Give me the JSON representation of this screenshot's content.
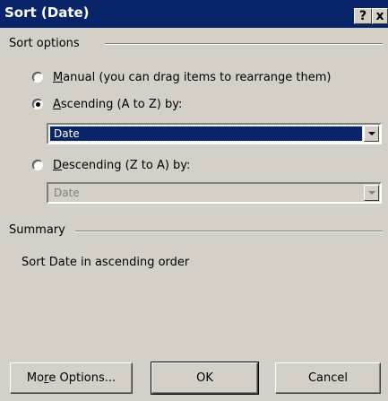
{
  "window": {
    "title": "Sort (Date)",
    "help_glyph": "?",
    "close_glyph": "x"
  },
  "sort_options": {
    "group_label": "Sort options",
    "manual": {
      "access_key": "M",
      "rest": "anual (you can drag items to rearrange them)",
      "selected": false
    },
    "ascending": {
      "access_key": "A",
      "rest": "scending (A to Z) by:",
      "selected": true,
      "field_value": "Date"
    },
    "descending": {
      "access_key": "D",
      "rest": "escending (Z to A) by:",
      "selected": false,
      "field_value": "Date"
    }
  },
  "summary": {
    "group_label": "Summary",
    "text": "Sort Date in ascending order"
  },
  "buttons": {
    "more_options": {
      "pre": "Mo",
      "access_key": "r",
      "post": "e Options..."
    },
    "ok": "OK",
    "cancel": "Cancel"
  },
  "colors": {
    "face": "#d4d0c8",
    "title_bar": "#0a246a",
    "selection": "#0a246a"
  }
}
